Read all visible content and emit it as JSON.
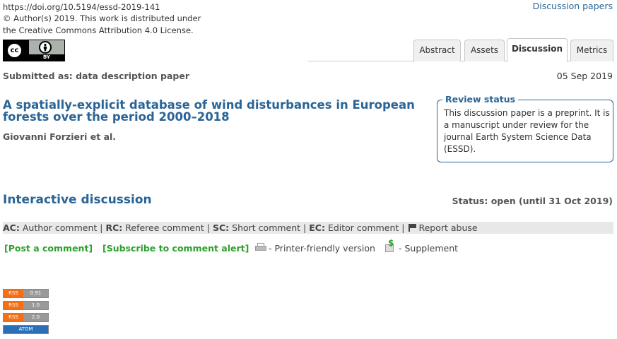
{
  "header": {
    "doi": "https://doi.org/10.5194/essd-2019-141",
    "copyright_line1": "© Author(s) 2019. This work is distributed under",
    "copyright_line2": "the Creative Commons Attribution 4.0 License.",
    "license_badge": {
      "left": "cc",
      "right": "BY"
    },
    "discussion_papers_link": "Discussion papers"
  },
  "tabs": [
    {
      "label": "Abstract",
      "active": false
    },
    {
      "label": "Assets",
      "active": false
    },
    {
      "label": "Discussion",
      "active": true
    },
    {
      "label": "Metrics",
      "active": false
    }
  ],
  "paper": {
    "submitted_as": "Submitted as: data description paper",
    "date": "05 Sep 2019",
    "title": "A spatially-explicit database of wind disturbances in European forests over the period 2000–2018",
    "authors": "Giovanni Forzieri et al."
  },
  "review_status": {
    "heading": "Review status",
    "text": "This discussion paper is a preprint. It is a manuscript under review for the journal Earth System Science Data (ESSD)."
  },
  "discussion": {
    "heading": "Interactive discussion",
    "status": "Status: open (until 31 Oct 2019)",
    "legend": {
      "ac_abbr": "AC:",
      "ac_label": "Author comment",
      "rc_abbr": "RC:",
      "rc_label": "Referee comment",
      "sc_abbr": "SC:",
      "sc_label": "Short comment",
      "ec_abbr": "EC:",
      "ec_label": "Editor comment",
      "report_label": "Report abuse",
      "separator": "|"
    },
    "actions": {
      "post_comment": "[Post a comment]",
      "subscribe": "[Subscribe to comment alert]",
      "printer": "- Printer-friendly version",
      "supplement": "- Supplement"
    }
  },
  "feeds": [
    {
      "left": "RSS",
      "right": "0.91"
    },
    {
      "left": "RSS",
      "right": "1.0"
    },
    {
      "left": "RSS",
      "right": "2.0"
    },
    {
      "label": "ATOM"
    }
  ],
  "colors": {
    "accent_blue": "#2a6496",
    "green_link": "#2ca02c",
    "rss_orange": "#f46f16",
    "atom_blue": "#2a6fb7"
  }
}
